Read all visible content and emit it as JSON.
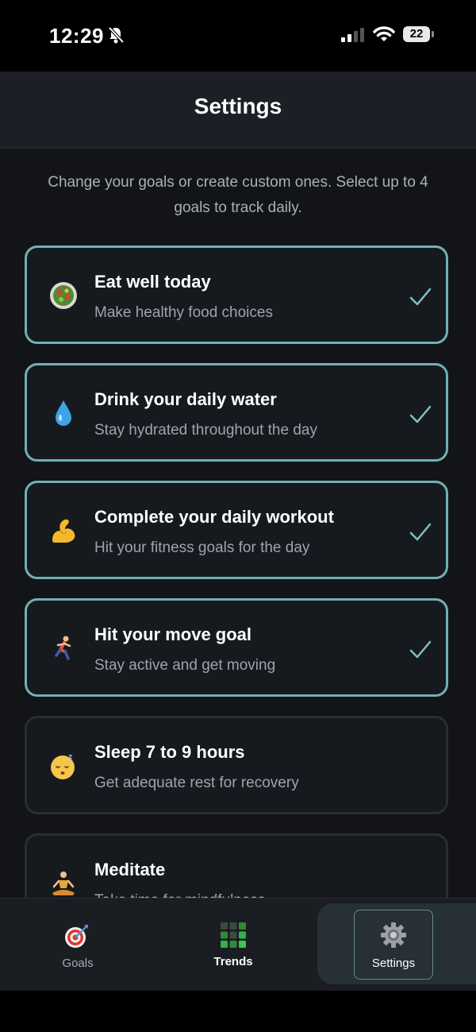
{
  "status_bar": {
    "time": "12:29",
    "battery": "22",
    "icons": [
      "bell-slash-icon",
      "cellular-signal-icon",
      "wifi-icon",
      "battery-icon"
    ]
  },
  "header": {
    "title": "Settings"
  },
  "intro": "Change your goals or create custom ones. Select up to 4 goals to track daily.",
  "goals": [
    {
      "title": "Eat well today",
      "subtitle": "Make healthy food choices",
      "icon": "salad-icon",
      "selected": true
    },
    {
      "title": "Drink your daily water",
      "subtitle": "Stay hydrated throughout the day",
      "icon": "water-drop-icon",
      "selected": true
    },
    {
      "title": "Complete your daily workout",
      "subtitle": "Hit your fitness goals for the day",
      "icon": "flexed-biceps-icon",
      "selected": true
    },
    {
      "title": "Hit your move goal",
      "subtitle": "Stay active and get moving",
      "icon": "running-person-icon",
      "selected": true
    },
    {
      "title": "Sleep 7 to 9 hours",
      "subtitle": "Get adequate rest for recovery",
      "icon": "sleeping-face-icon",
      "selected": false
    },
    {
      "title": "Meditate",
      "subtitle": "Take time for mindfulness",
      "icon": "meditation-icon",
      "selected": false
    }
  ],
  "tab_bar": {
    "tabs": [
      {
        "label": "Goals",
        "icon": "target-icon",
        "active": false
      },
      {
        "label": "Trends",
        "icon": "grid-chart-icon",
        "active": false
      },
      {
        "label": "Settings",
        "icon": "gear-icon",
        "active": true
      }
    ]
  },
  "colors": {
    "background": "#121418",
    "header": "#1c1f26",
    "selected_border": "#6fb1b5",
    "card_border": "#2a2d33",
    "check": "#7fc0c4",
    "active_tab_bg": "#263035"
  }
}
